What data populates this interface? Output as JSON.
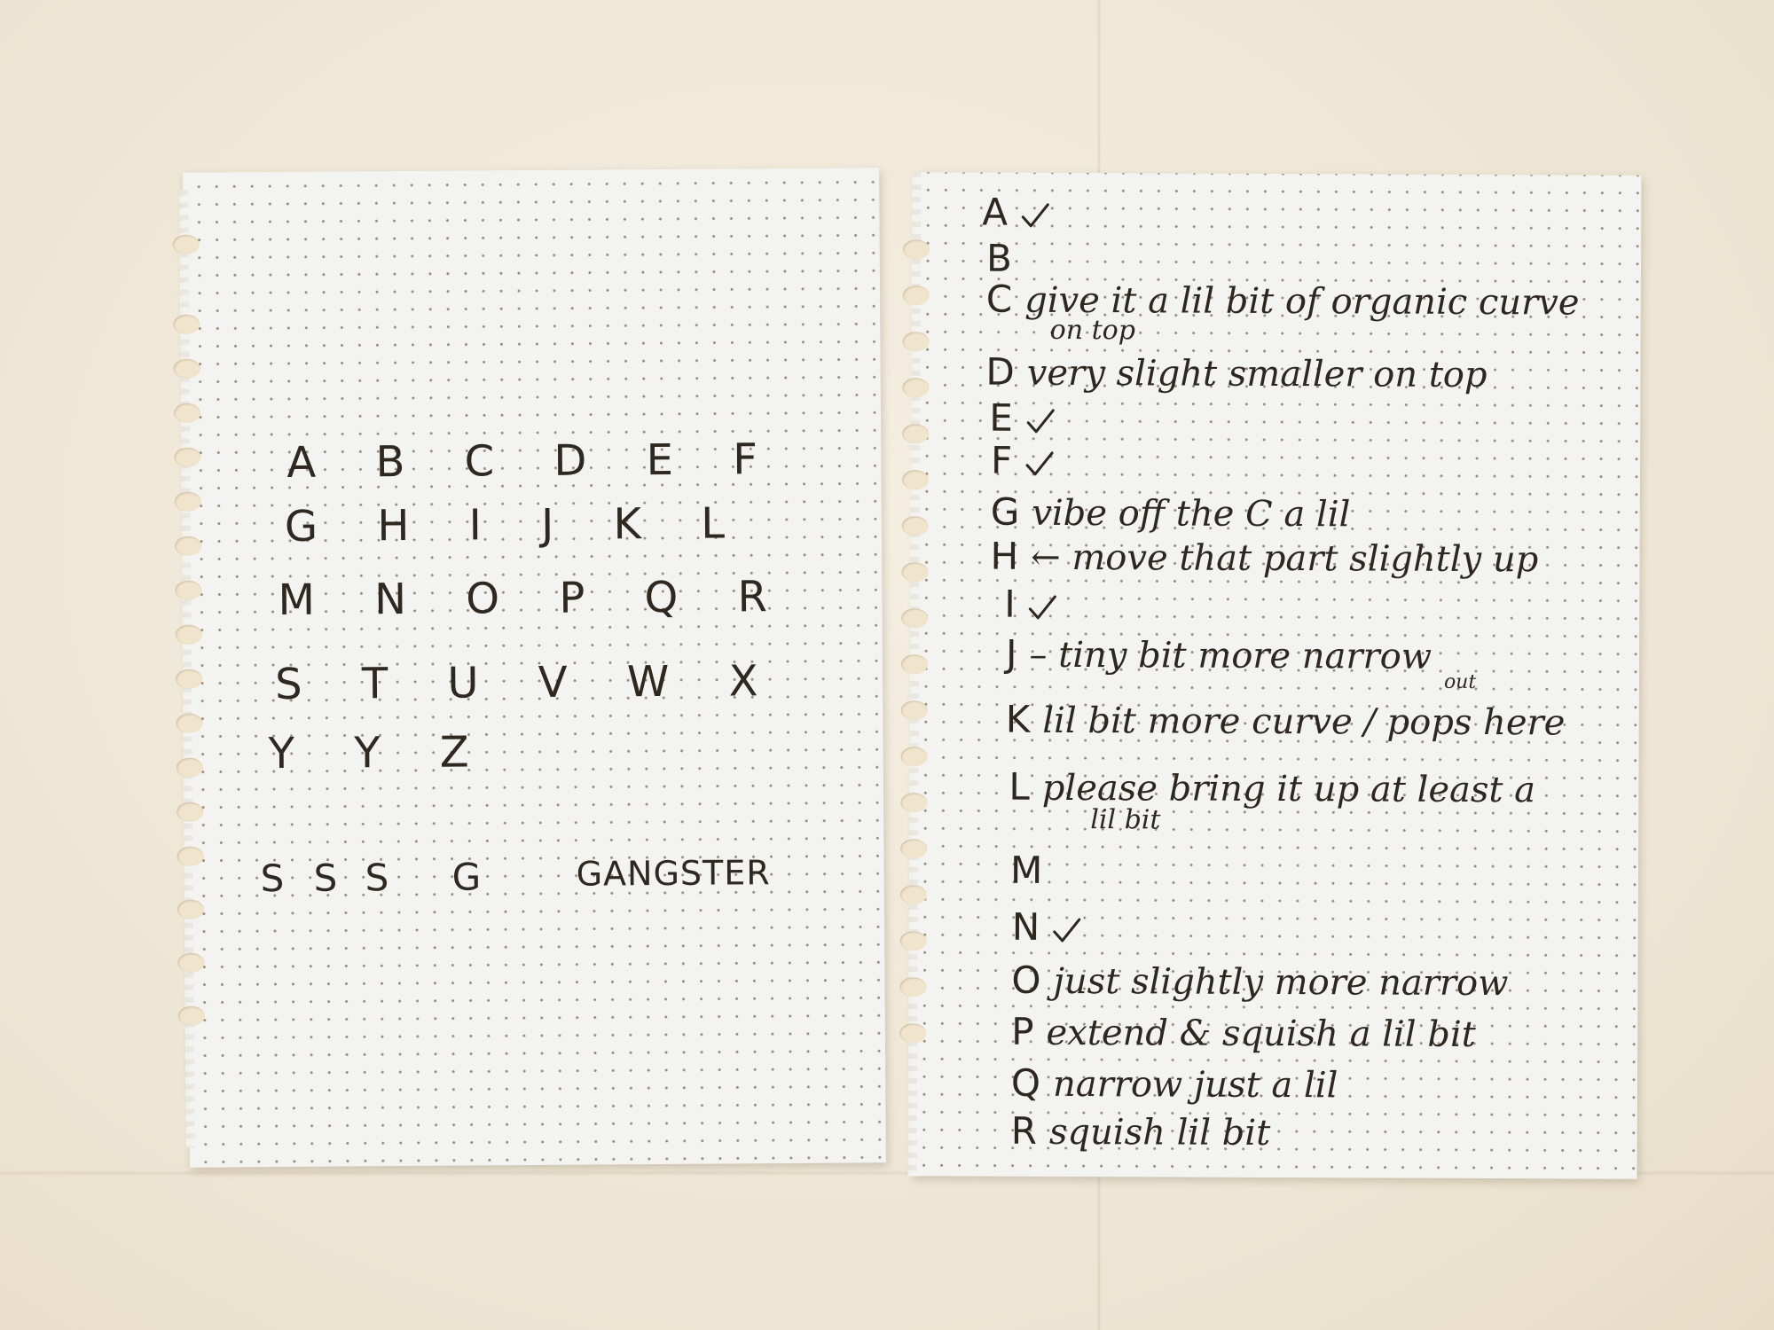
{
  "left_page": {
    "alphabet_rows": [
      "A B C D E F",
      "G H I J K L",
      "M N O P Q R",
      "S T U V W X",
      "Y Y Z"
    ],
    "samples": [
      "S",
      "S",
      "S",
      "G"
    ],
    "word": "GANGSTER"
  },
  "right_page": {
    "notes": [
      {
        "letter": "A",
        "text": "",
        "check": true
      },
      {
        "letter": "B",
        "text": "",
        "check": false
      },
      {
        "letter": "C",
        "text": "give it a lil bit of organic curve",
        "text2": "on top",
        "check": false
      },
      {
        "letter": "D",
        "text": "very slight smaller on top",
        "check": false
      },
      {
        "letter": "E",
        "text": "",
        "check": true
      },
      {
        "letter": "F",
        "text": "",
        "check": true
      },
      {
        "letter": "G",
        "text": "vibe off the C a lil",
        "check": false
      },
      {
        "letter": "H",
        "text": "← move that part slightly up",
        "check": false
      },
      {
        "letter": "I",
        "text": "",
        "check": true
      },
      {
        "letter": "J",
        "text": "– tiny bit more narrow",
        "check": false
      },
      {
        "letter": "K",
        "text": "lil bit more curve / pops here",
        "superscript": "out",
        "check": false
      },
      {
        "letter": "L",
        "text": "please bring it up at least a",
        "text2": "lil bit",
        "check": false
      },
      {
        "letter": "M",
        "text": "",
        "check": false
      },
      {
        "letter": "N",
        "text": "",
        "check": true
      },
      {
        "letter": "O",
        "text": "just slightly more narrow",
        "check": false
      },
      {
        "letter": "P",
        "text": "extend & squish a lil bit",
        "check": false
      },
      {
        "letter": "Q",
        "text": "narrow just a lil",
        "check": false
      },
      {
        "letter": "R",
        "text": "squish lil bit",
        "check": false
      }
    ]
  },
  "colors": {
    "ink": "#2e2720",
    "paper": "#f3f3f1",
    "desk": "#f1ebdc"
  }
}
